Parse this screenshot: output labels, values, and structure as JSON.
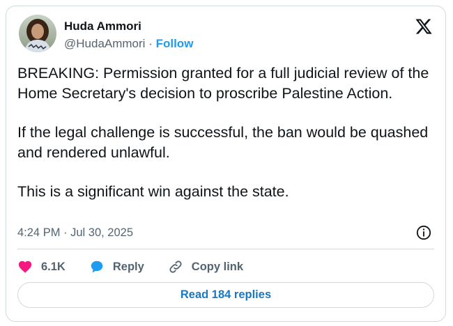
{
  "author": {
    "name": "Huda Ammori",
    "handle": "@HudaAmmori",
    "separator": "·",
    "follow_label": "Follow",
    "avatar_icon": "profile-photo"
  },
  "platform": {
    "logo_icon": "x-logo"
  },
  "tweet": {
    "paragraphs": [
      "BREAKING: Permission granted for a full judicial review of the Home Secretary's decision to proscribe Palestine Action.",
      "If the legal challenge is successful, the ban would be quashed and rendered unlawful.",
      "This is a significant win against the state."
    ],
    "timestamp": "4:24 PM · Jul 30, 2025"
  },
  "actions": {
    "like_count": "6.1K",
    "reply_label": "Reply",
    "copy_link_label": "Copy link"
  },
  "read_replies_label": "Read 184 replies",
  "colors": {
    "accent": "#1d9bf0",
    "like": "#f91880",
    "text": "#0f1419",
    "secondary": "#536471",
    "border": "#cfd9de"
  }
}
